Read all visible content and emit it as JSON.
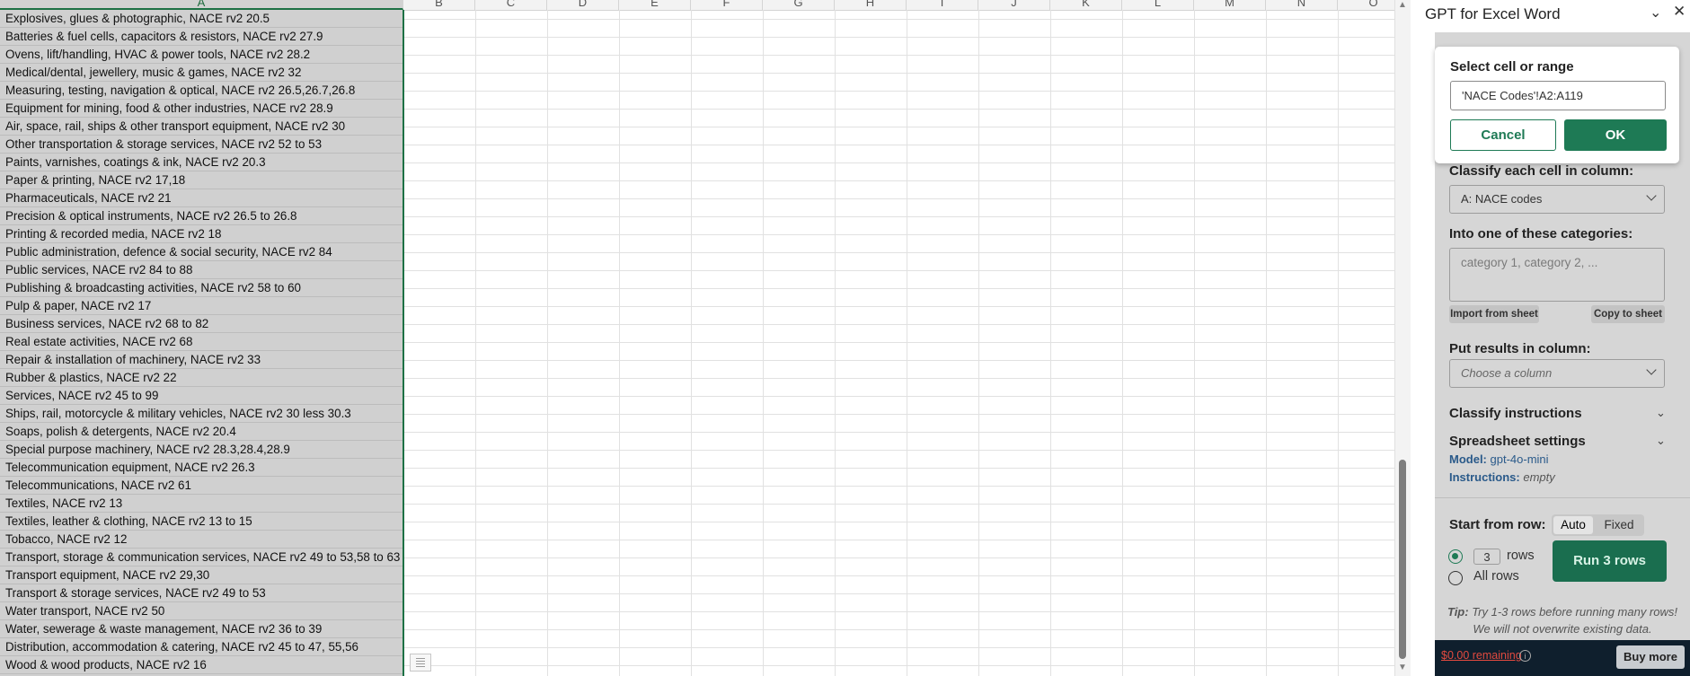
{
  "sheet": {
    "columns": [
      "A",
      "B",
      "C",
      "D",
      "E",
      "F",
      "G",
      "H",
      "I",
      "J",
      "K",
      "L",
      "M",
      "N",
      "O"
    ],
    "rows": [
      "Explosives, glues & photographic, NACE rv2 20.5",
      "Batteries & fuel cells, capacitors & resistors, NACE rv2 27.9",
      "Ovens, lift/handling, HVAC & power tools, NACE rv2 28.2",
      "Medical/dental, jewellery, music & games, NACE rv2 32",
      "Measuring, testing, navigation & optical, NACE rv2 26.5,26.7,26.8",
      "Equipment for mining, food & other industries, NACE rv2 28.9",
      "Air, space, rail, ships & other transport equipment, NACE rv2 30",
      "Other transportation & storage services, NACE rv2 52 to 53",
      "Paints, varnishes, coatings & ink, NACE rv2 20.3",
      "Paper & printing, NACE rv2 17,18",
      "Pharmaceuticals, NACE rv2 21",
      "Precision & optical instruments, NACE rv2 26.5 to 26.8",
      "Printing & recorded media, NACE rv2 18",
      "Public administration, defence & social security, NACE rv2 84",
      "Public services, NACE rv2 84 to 88",
      "Publishing & broadcasting activities, NACE rv2 58 to 60",
      "Pulp & paper, NACE rv2 17",
      "Business services, NACE rv2 68 to 82",
      "Real estate activities, NACE rv2 68",
      "Repair & installation of machinery, NACE rv2 33",
      "Rubber & plastics, NACE rv2 22",
      "Services, NACE rv2 45 to 99",
      "Ships, rail, motorcycle & military vehicles, NACE rv2 30 less 30.3",
      "Soaps, polish & detergents, NACE rv2 20.4",
      "Special purpose machinery, NACE rv2 28.3,28.4,28.9",
      "Telecommunication equipment, NACE rv2 26.3",
      "Telecommunications, NACE rv2 61",
      "Textiles, NACE rv2 13",
      "Textiles, leather & clothing, NACE rv2 13 to 15",
      "Tobacco, NACE rv2 12",
      "Transport, storage & communication services, NACE rv2 49 to 53,58 to 63",
      "Transport equipment, NACE rv2 29,30",
      "Transport & storage services, NACE rv2 49 to 53",
      "Water transport, NACE rv2 50",
      "Water, sewerage & waste management, NACE rv2 36 to 39",
      "Distribution, accommodation & catering, NACE rv2 45 to 47, 55,56",
      "Wood & wood products, NACE rv2 16"
    ]
  },
  "pane": {
    "title": "GPT for Excel Word",
    "classify_column_label": "Classify each cell in column:",
    "classify_column_value": "A: NACE codes",
    "categories_label": "Into one of these categories:",
    "categories_placeholder": "category 1, category 2, ...",
    "import_label": "Import from sheet",
    "copy_label": "Copy to sheet",
    "results_label": "Put results in column:",
    "results_placeholder": "Choose a column",
    "classify_instructions": "Classify instructions",
    "spreadsheet_settings": "Spreadsheet settings",
    "model_key": "Model:",
    "model_value": "gpt-4o-mini",
    "instructions_key": "Instructions:",
    "instructions_value": "empty",
    "start_row_label": "Start from row:",
    "auto_label": "Auto",
    "fixed_label": "Fixed",
    "rows_count": "3",
    "rows_label": "rows",
    "all_rows_label": "All rows",
    "run_label": "Run 3 rows",
    "tip_bold": "Tip:",
    "tip_text": "Try 1-3 rows before running many rows!",
    "tip_text2": "We will not overwrite existing data.",
    "credit": "$0.00 remaining",
    "buy_label": "Buy more"
  },
  "dialog": {
    "label": "Select cell or range",
    "value": "'NACE Codes'!A2:A119",
    "cancel": "Cancel",
    "ok": "OK"
  },
  "colors": {
    "accent": "#1e7a55",
    "credit_red": "#e34a3f",
    "footer_bg": "#0f1f2d"
  }
}
